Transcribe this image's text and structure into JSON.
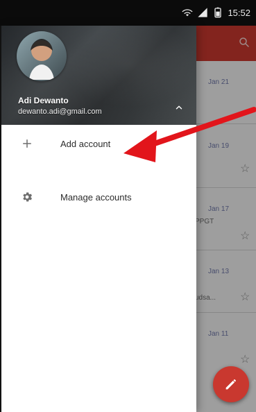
{
  "status_bar": {
    "time": "15:52",
    "icons": [
      "wifi-icon",
      "signal-icon",
      "battery-icon"
    ]
  },
  "drawer": {
    "account": {
      "name": "Adi Dewanto",
      "email": "dewanto.adi@gmail.com"
    },
    "menu": {
      "add_account": "Add account",
      "manage_accounts": "Manage accounts"
    }
  },
  "background_list": {
    "dates": [
      "Jan 21",
      "Jan 19",
      "Jan 17",
      "Jan 13",
      "Jan 11"
    ],
    "snippets": [
      "PPGT",
      "...",
      "udsa..."
    ]
  },
  "colors": {
    "accent_red": "#c9382f",
    "drawer_bg": "#ffffff",
    "text_primary": "#2b2b2b",
    "status_bar": "#0b0b0b"
  }
}
